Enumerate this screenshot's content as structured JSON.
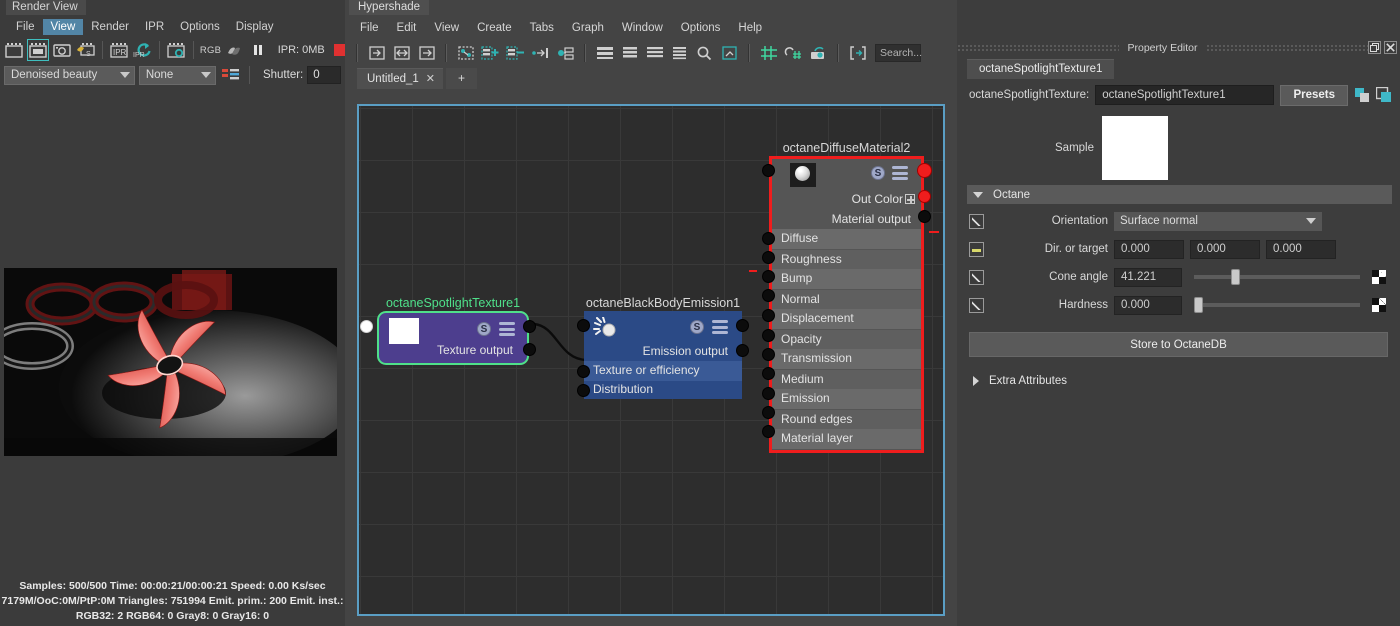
{
  "render_view": {
    "window_title": "Render View",
    "menus": [
      {
        "label": "File",
        "active": false
      },
      {
        "label": "View",
        "active": true
      },
      {
        "label": "Render",
        "active": false
      },
      {
        "label": "IPR",
        "active": false
      },
      {
        "label": "Options",
        "active": false
      },
      {
        "label": "Display",
        "active": false
      }
    ],
    "toolbar": {
      "icons": [
        {
          "name": "render-region-icon",
          "selected": false
        },
        {
          "name": "render-frame-icon",
          "selected": true
        },
        {
          "name": "snapshot-icon",
          "selected": false
        },
        {
          "name": "render-sequence-icon",
          "selected": false
        },
        {
          "name": "ipr-render-region-icon",
          "selected": false
        },
        {
          "name": "ipr-refresh-icon",
          "selected": false
        },
        {
          "name": "render-settings-icon",
          "selected": false
        }
      ],
      "rgb_label": "RGB",
      "ipr_status": "IPR: 0MB",
      "stop_swatch_color": "#e03131"
    },
    "options_row": {
      "render_pass": "Denoised beauty",
      "camera": "None",
      "shutter_label": "Shutter:",
      "shutter_value": "0"
    },
    "status_lines": [
      "Samples: 500/500 Time: 00:00:21/00:00:21 Speed: 0.00 Ks/sec",
      "7179M/OoC:0M/PtP:0M Triangles: 751994 Emit. prim.: 200 Emit. inst.:",
      "RGB32: 2 RGB64: 0 Gray8: 0 Gray16: 0"
    ]
  },
  "hypershade": {
    "window_title": "Hypershade",
    "menus": [
      "File",
      "Edit",
      "View",
      "Create",
      "Tabs",
      "Graph",
      "Window",
      "Options",
      "Help"
    ],
    "toolbar_icons": [
      "graph-input-connections-icon",
      "graph-input-output-connections-icon",
      "graph-output-connections-icon",
      "rearrange-graph-icon",
      "add-selected-to-graph-icon",
      "remove-selected-from-graph-icon",
      "show-upstream-icon",
      "show-downstream-icon",
      "layout-horizontal-1-icon",
      "layout-horizontal-2-icon",
      "layout-horizontal-3-icon",
      "layout-horizontal-4-icon",
      "zoom-search-icon",
      "frame-all-icon",
      "grid-snap-icon",
      "snap-to-grid-icon",
      "camera-snapshot-icon",
      "fit-view-icon"
    ],
    "search_placeholder": "Search...",
    "tabs": [
      {
        "label": "Untitled_1",
        "closable": true
      }
    ],
    "add_tab_label": "+",
    "graph": {
      "nodes": [
        {
          "id": "spotlight",
          "title": "octaneSpotlightTexture1",
          "title_color": "#4fe08a",
          "body_color": "#4d3e8e",
          "border_color": "#4fe08a",
          "swatch_color": "#ffffff",
          "badge_s": "S",
          "rows": [
            "Texture output"
          ]
        },
        {
          "id": "blackbody",
          "title": "octaneBlackBodyEmission1",
          "title_color": "#d8d8d8",
          "body_color": "#2b4a86",
          "badge_s": "S",
          "rows": [
            "Emission output",
            "Texture or efficiency",
            "Distribution"
          ]
        },
        {
          "id": "diffuse",
          "title": "octaneDiffuseMaterial2",
          "title_color": "#d8d8d8",
          "body_color": "#555555",
          "border_color": "#ef1d1d",
          "badge_s": "S",
          "out_rows": [
            "Out Color",
            "Material output"
          ],
          "rows": [
            "Diffuse",
            "Roughness",
            "Bump",
            "Normal",
            "Displacement",
            "Opacity",
            "Transmission",
            "Medium",
            "Emission",
            "Round edges",
            "Material layer"
          ]
        }
      ]
    }
  },
  "property_editor": {
    "panel_title": "Property Editor",
    "tab_label": "octaneSpotlightTexture1",
    "name_label": "octaneSpotlightTexture:",
    "name_value": "octaneSpotlightTexture1",
    "presets_label": "Presets",
    "sample_label": "Sample",
    "sample_color": "#ffffff",
    "sections": [
      {
        "label": "Octane",
        "expanded": true
      },
      {
        "label": "Extra Attributes",
        "expanded": false
      }
    ],
    "attributes": [
      {
        "label": "Orientation",
        "type": "dropdown",
        "value": "Surface normal",
        "checkbox": "anim"
      },
      {
        "label": "Dir. or target",
        "type": "vector3",
        "values": [
          "0.000",
          "0.000",
          "0.000"
        ],
        "checkbox": "dash"
      },
      {
        "label": "Cone angle",
        "type": "slider",
        "value": "41.221",
        "slider_pct": 22,
        "checkbox": "anim"
      },
      {
        "label": "Hardness",
        "type": "slider",
        "value": "0.000",
        "slider_pct": 0,
        "checkbox": "anim"
      }
    ],
    "store_button": "Store to OctaneDB",
    "window_buttons": [
      "restore-icon",
      "close-icon"
    ]
  }
}
